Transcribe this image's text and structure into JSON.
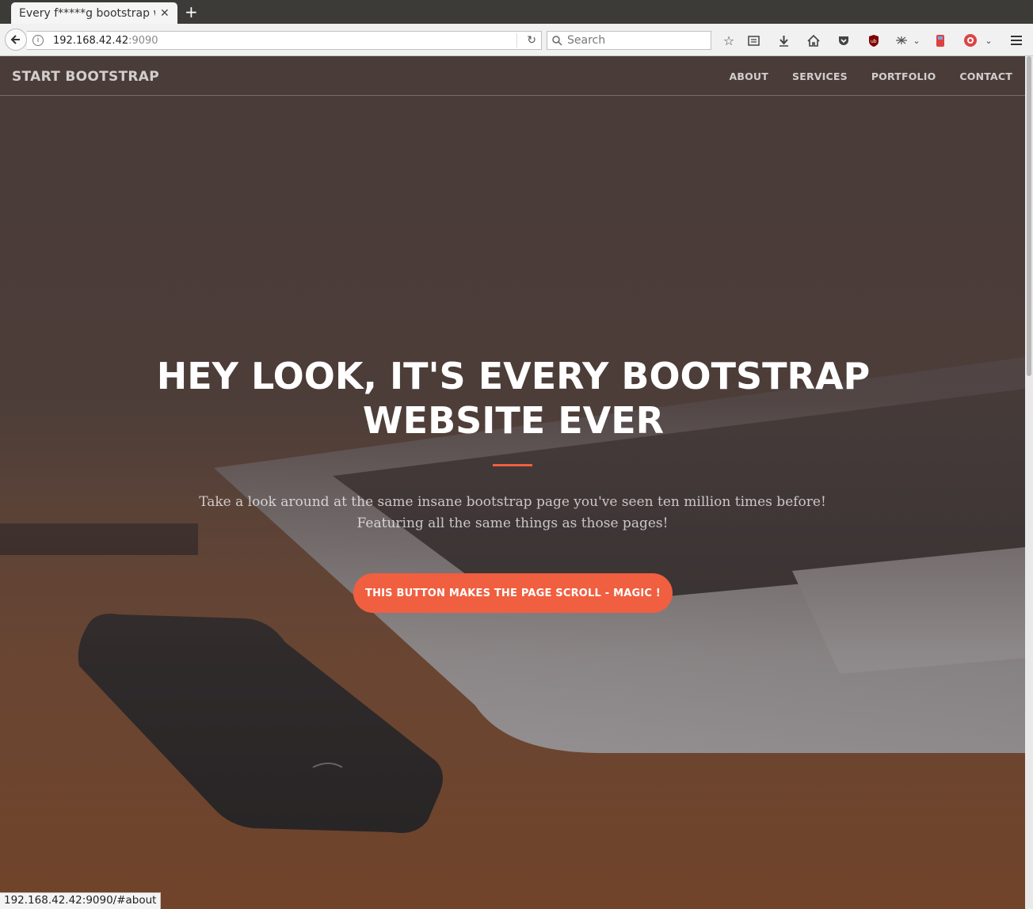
{
  "browser": {
    "tab_title": "Every f*****g bootstrap website ever",
    "tab_close": "✕",
    "new_tab": "+",
    "url_host": "192.168.42.42",
    "url_port": ":9090",
    "search_placeholder": "Search",
    "toolbar_icons": [
      "bookmark-star-icon",
      "reader-list-icon",
      "download-icon",
      "home-icon",
      "pocket-icon",
      "ublock-icon",
      "extension-icon",
      "battery-extension-icon",
      "addon-icon",
      "hamburger-menu-icon"
    ]
  },
  "site": {
    "brand": "START BOOTSTRAP",
    "nav": [
      "ABOUT",
      "SERVICES",
      "PORTFOLIO",
      "CONTACT"
    ],
    "hero_title": "HEY LOOK, IT'S EVERY BOOTSTRAP WEBSITE EVER",
    "hero_subtitle": "Take a look around at the same insane bootstrap page you've seen ten million times before! Featuring all the same things as those pages!",
    "cta": "THIS BUTTON MAKES THE PAGE SCROLL - MAGIC !",
    "accent_color": "#f05f40"
  },
  "status_url": "192.168.42.42:9090/#about"
}
